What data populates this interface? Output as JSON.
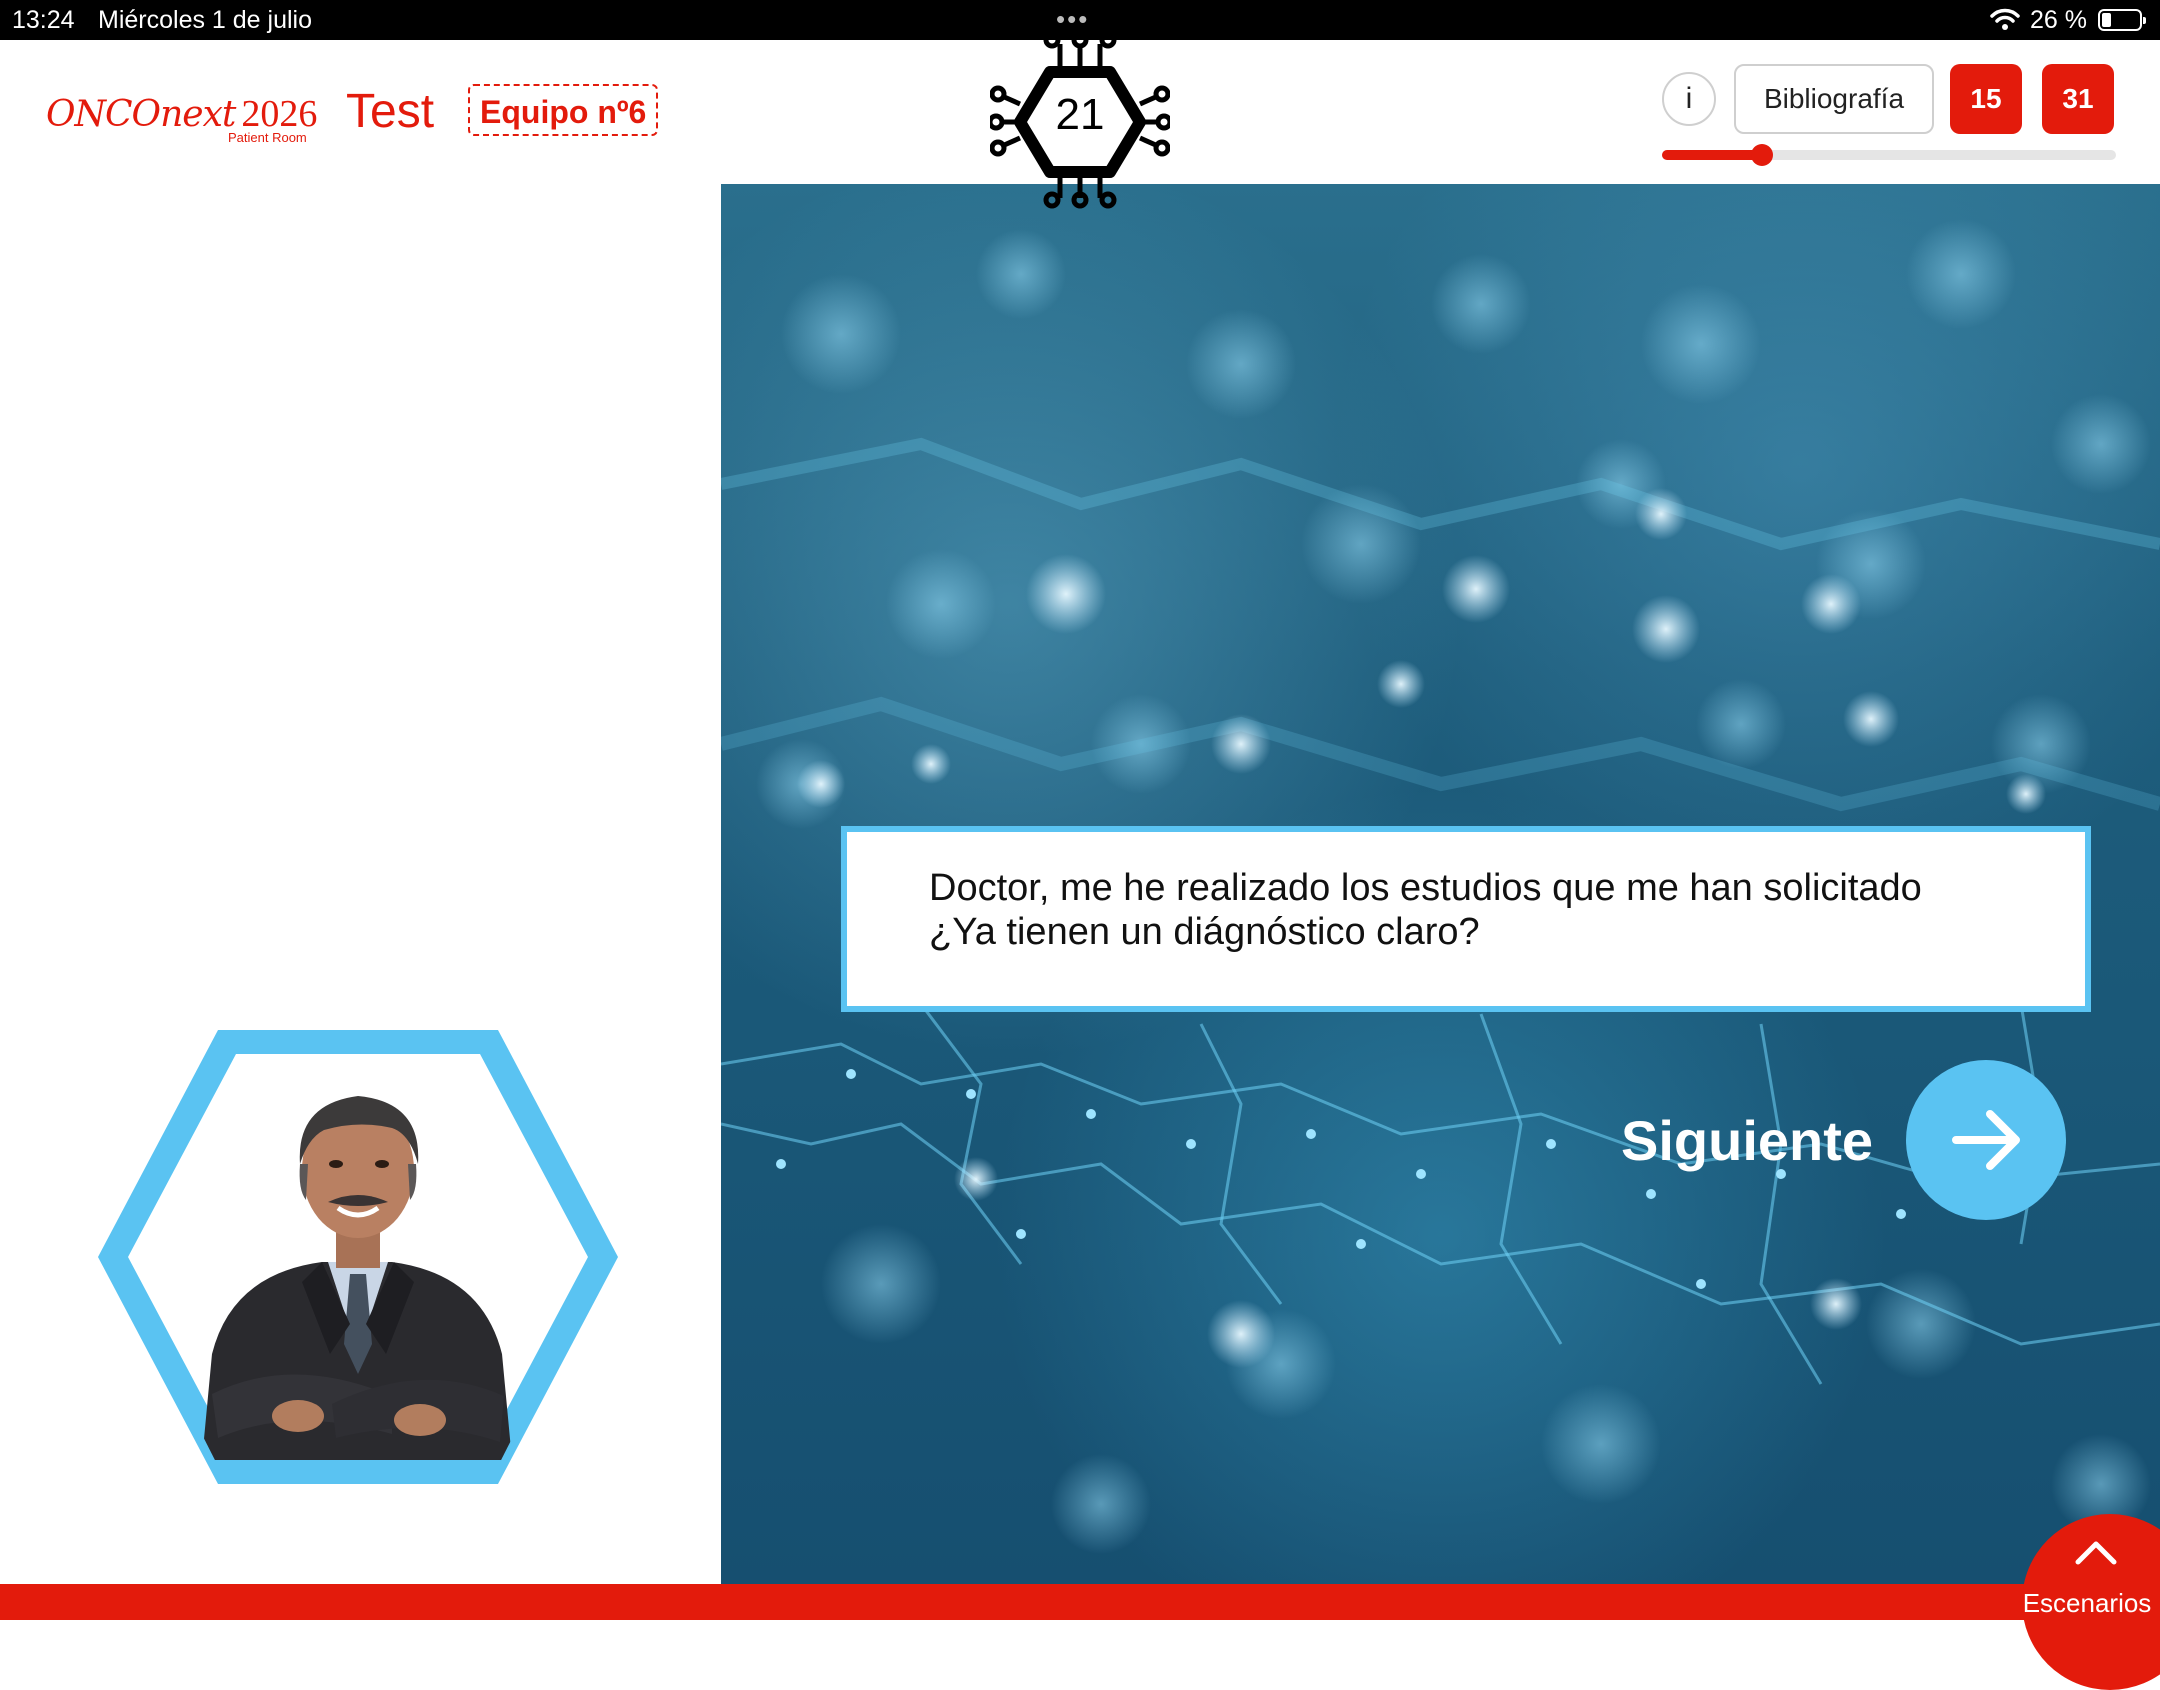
{
  "status_bar": {
    "time": "13:24",
    "date": "Miércoles 1 de julio",
    "battery": "26 %",
    "battery_level": 0.26
  },
  "header": {
    "logo_word": "ONCOnext",
    "logo_year": "2026",
    "logo_sub": "Patient Room",
    "title": "Test",
    "team": "Equipo nº6",
    "counter": "21",
    "info_label": "i",
    "bibliography_label": "Bibliografía",
    "badge_1": "15",
    "badge_2": "31",
    "progress": 0.22
  },
  "scene": {
    "dialog_line_1": "Doctor, me he realizado los estudios que me han solicitado",
    "dialog_line_2": "¿Ya tienen un diágnóstico claro?",
    "next_label": "Siguiente"
  },
  "footer": {
    "scenarios_label": "Escenarios"
  },
  "colors": {
    "brand_red": "#e31b0c",
    "accent_blue": "#5ac3f2",
    "scene_blue": "#1e5d7c"
  },
  "icons": {
    "counter": "circuit-hexagon-icon",
    "next": "arrow-right-icon",
    "scenarios": "chevron-up-icon",
    "wifi": "wifi-icon",
    "battery": "battery-icon"
  }
}
